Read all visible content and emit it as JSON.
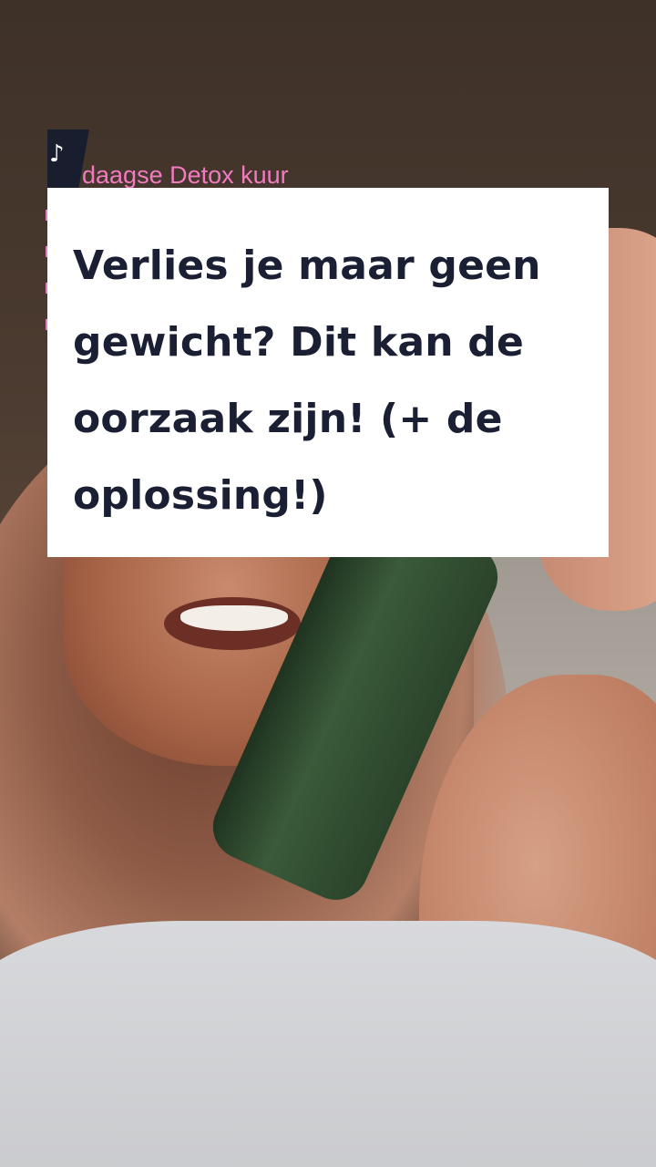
{
  "background_caption": "daagse Detox kuur",
  "overlay_card": {
    "headline": "Verlies je maar geen gewicht? Dit kan de oorzaak zijn! (+ de oplossing!)"
  },
  "colors": {
    "card_background": "#ffffff",
    "headline_text": "#1a1f33",
    "caption_pink": "#f27ac0",
    "logo_dark": "#181e2e"
  },
  "icons": {
    "brand_logo": "logo-icon"
  }
}
